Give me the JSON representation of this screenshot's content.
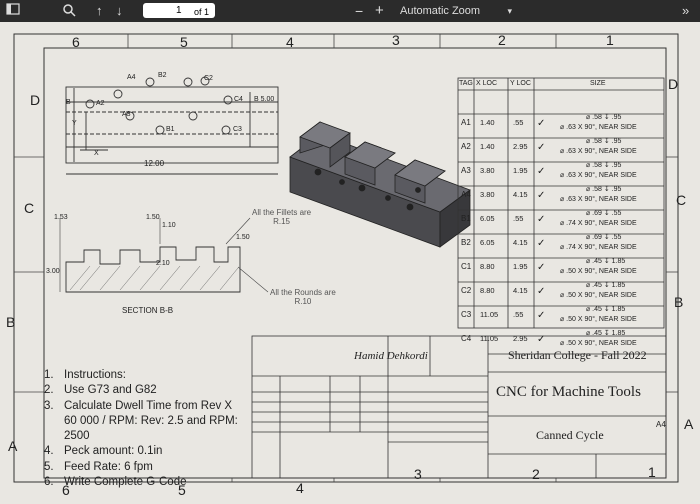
{
  "toolbar": {
    "page_current": "1",
    "page_of": "of 1",
    "zoom_minus": "−",
    "zoom_plus": "+",
    "zoom_label": "Automatic Zoom",
    "more": "»"
  },
  "border": {
    "top_cols": [
      "6",
      "5",
      "4",
      "3",
      "2",
      "1"
    ],
    "bottom_cols": [
      "6",
      "5",
      "4",
      "3",
      "2",
      "1"
    ],
    "left_rows": [
      "D",
      "C",
      "B",
      "A"
    ],
    "right_rows": [
      "D",
      "C",
      "B",
      "A"
    ]
  },
  "drawing": {
    "holes_top": [
      "A4",
      "B2",
      "C2"
    ],
    "holes_row2": [
      "A2",
      "A3",
      "C4",
      "B 5.00"
    ],
    "holes_row3": [
      "B1",
      "C3"
    ],
    "width_dim": "12.00",
    "b_label": "B",
    "y_label": "Y",
    "x_label": "X",
    "section_dims": [
      "1.53",
      "1.50",
      "1.10",
      "1.50",
      "2.10",
      "3.00"
    ],
    "fillet_note": [
      "All the Fillets are",
      "R.15"
    ],
    "round_note": [
      "All the Rounds are",
      "R.10"
    ],
    "section_label": "SECTION B-B"
  },
  "hole_table": {
    "headers": [
      "TAG",
      "X LOC",
      "Y LOC",
      "SIZE"
    ],
    "rows": [
      {
        "tag": "A1",
        "x": "1.40",
        "y": ".55",
        "size1": "⌀ .58 ↧ .95",
        "size2": "⌀ .63 X 90°, NEAR SIDE"
      },
      {
        "tag": "A2",
        "x": "1.40",
        "y": "2.95",
        "size1": "⌀ .58 ↧ .95",
        "size2": "⌀ .63 X 90°, NEAR SIDE"
      },
      {
        "tag": "A3",
        "x": "3.80",
        "y": "1.95",
        "size1": "⌀ .58 ↧ .95",
        "size2": "⌀ .63 X 90°, NEAR SIDE"
      },
      {
        "tag": "A4",
        "x": "3.80",
        "y": "4.15",
        "size1": "⌀ .58 ↧ .95",
        "size2": "⌀ .63 X 90°, NEAR SIDE"
      },
      {
        "tag": "B1",
        "x": "6.05",
        "y": ".55",
        "size1": "⌀ .69 ↧ .55",
        "size2": "⌀ .74 X 90°, NEAR SIDE"
      },
      {
        "tag": "B2",
        "x": "6.05",
        "y": "4.15",
        "size1": "⌀ .69 ↧ .55",
        "size2": "⌀ .74 X 90°, NEAR SIDE"
      },
      {
        "tag": "C1",
        "x": "8.80",
        "y": "1.95",
        "size1": "⌀ .45 ↧ 1.85",
        "size2": "⌀ .50 X 90°, NEAR SIDE"
      },
      {
        "tag": "C2",
        "x": "8.80",
        "y": "4.15",
        "size1": "⌀ .45 ↧ 1.85",
        "size2": "⌀ .50 X 90°, NEAR SIDE"
      },
      {
        "tag": "C3",
        "x": "11.05",
        "y": ".55",
        "size1": "⌀ .45 ↧ 1.85",
        "size2": "⌀ .50 X 90°, NEAR SIDE"
      },
      {
        "tag": "C4",
        "x": "11.05",
        "y": "2.95",
        "size1": "⌀ .45 ↧ 1.85",
        "size2": "⌀ .50 X 90°, NEAR SIDE"
      }
    ]
  },
  "instructions": [
    {
      "n": "1.",
      "text": "Instructions:"
    },
    {
      "n": "2.",
      "text": "Use G73 and G82"
    },
    {
      "n": "3.",
      "text": "Calculate Dwell Time from Rev X"
    },
    {
      "n": "",
      "text": "60 000 / RPM: Rev: 2.5 and RPM:"
    },
    {
      "n": "",
      "text": "2500"
    },
    {
      "n": "4.",
      "text": "Peck amount: 0.1in"
    },
    {
      "n": "5.",
      "text": "Feed Rate: 6 fpm"
    },
    {
      "n": "6.",
      "text": "Write Complete G-Code"
    }
  ],
  "title_block": {
    "author": "Hamid Dehkordi",
    "school": "Sheridan College - Fall 2022",
    "title": "CNC for Machine Tools",
    "subtitle": "Canned Cycle",
    "size": "A4"
  },
  "colors": {
    "paper": "#e9e7e2",
    "part": "#4a4a4e",
    "toolbar": "#2b2b2b"
  }
}
